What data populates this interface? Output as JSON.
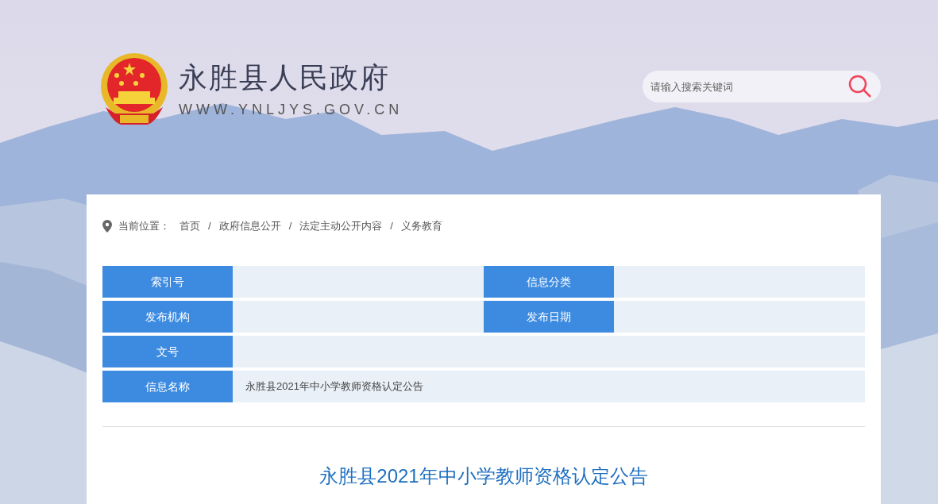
{
  "header": {
    "site_name": "永胜县人民政府",
    "site_url": "WWW.YNLJYS.GOV.CN",
    "search": {
      "placeholder": "请输入搜索关键词"
    }
  },
  "breadcrumb": {
    "label": "当前位置：",
    "items": [
      "首页",
      "政府信息公开",
      "法定主动公开内容",
      "义务教育"
    ],
    "separator": "/"
  },
  "info_rows": [
    {
      "cells": [
        {
          "label": "索引号"
        },
        {
          "label": "信息分类"
        }
      ]
    },
    {
      "cells": [
        {
          "label": "发布机构"
        },
        {
          "label": "发布日期"
        }
      ]
    },
    {
      "cells": [
        {
          "label": "文号"
        }
      ]
    },
    {
      "cells": [
        {
          "label": "信息名称",
          "value": "永胜县2021年中小学教师资格认定公告"
        }
      ]
    }
  ],
  "article": {
    "title": "永胜县2021年中小学教师资格认定公告"
  }
}
